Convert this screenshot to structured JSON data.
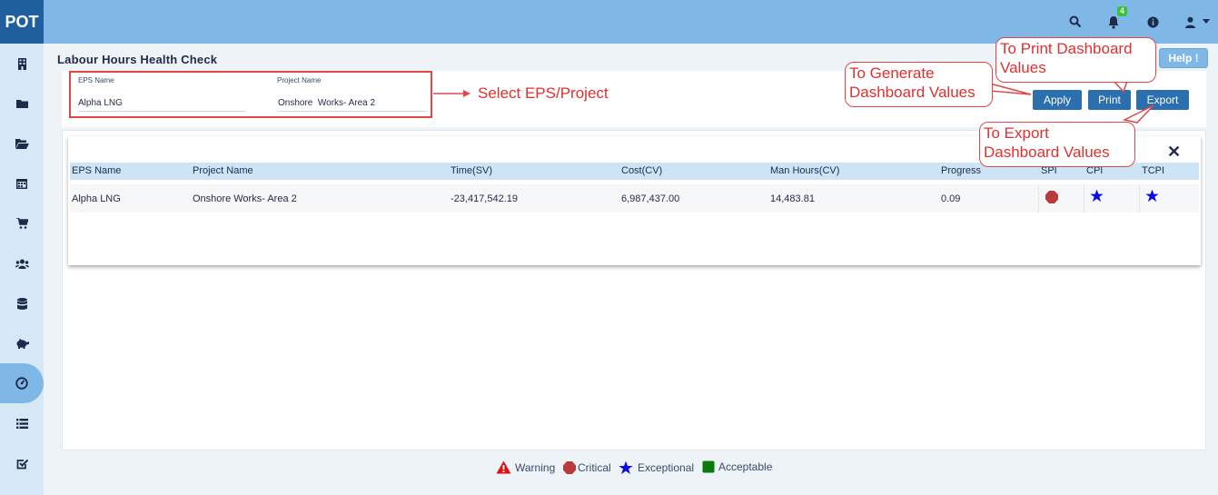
{
  "app": {
    "logo": "POT",
    "notification_count": "4"
  },
  "topbar": {
    "icons": [
      "search-icon",
      "bell-icon",
      "info-icon",
      "user-icon",
      "caret-down-icon"
    ]
  },
  "sidebar": {
    "items": [
      {
        "icon": "building-icon"
      },
      {
        "icon": "folder-icon"
      },
      {
        "icon": "folder-open-icon"
      },
      {
        "icon": "calendar-icon"
      },
      {
        "icon": "cart-icon"
      },
      {
        "icon": "users-icon"
      },
      {
        "icon": "database-icon"
      },
      {
        "icon": "piggy-bank-icon"
      },
      {
        "icon": "dashboard-gauge-icon",
        "active": true
      },
      {
        "icon": "list-icon"
      },
      {
        "icon": "checkbox-icon"
      }
    ]
  },
  "page": {
    "title": "Labour Hours Health Check",
    "help_label": "Help !"
  },
  "filters": {
    "eps": {
      "label": "EPS Name",
      "value": "Alpha LNG"
    },
    "project": {
      "label": "Project Name",
      "value": "Onshore  Works- Area 2"
    }
  },
  "buttons": {
    "apply": "Apply",
    "print": "Print",
    "export": "Export"
  },
  "annotations": {
    "select": "Select EPS/Project",
    "generate": "To Generate\nDashboard Values",
    "print": "To Print Dashboard\nValues",
    "export": "To Export\nDashboard Values"
  },
  "table": {
    "columns": [
      "EPS Name",
      "Project Name",
      "Time(SV)",
      "Cost(CV)",
      "Man Hours(CV)",
      "Progress",
      "SPI",
      "CPI",
      "TCPI"
    ],
    "rows": [
      {
        "eps": "Alpha LNG",
        "project": "Onshore Works- Area 2",
        "time_sv": "-23,417,542.19",
        "cost_cv": "6,987,437.00",
        "man_hours_cv": "14,483.81",
        "progress": "0.09",
        "spi": "critical",
        "cpi": "exceptional",
        "tcpi": "exceptional"
      }
    ]
  },
  "legend": [
    {
      "label": "Warning",
      "icon": "warning-triangle-icon",
      "color": "#e01010"
    },
    {
      "label": "Critical",
      "icon": "critical-hexagon-icon",
      "color": "#b83a3a"
    },
    {
      "label": "Exceptional",
      "icon": "exceptional-star-icon",
      "color": "#0a0ae6"
    },
    {
      "label": "Acceptable",
      "icon": "acceptable-square-icon",
      "color": "#0a7a0a"
    }
  ],
  "colors": {
    "topbar": "#7fb7e6",
    "logo_bg": "#1f5f9e",
    "sidebar": "#d6e7f5",
    "button": "#2c6fae",
    "annotation": "#e03030",
    "table_header": "#cde4f6"
  }
}
